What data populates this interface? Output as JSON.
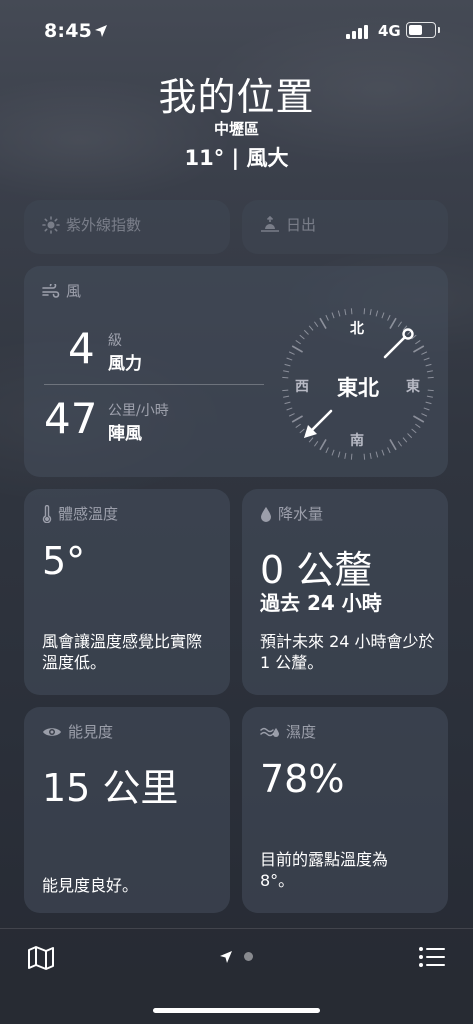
{
  "status_bar": {
    "time": "8:45",
    "network": "4G"
  },
  "header": {
    "title": "我的位置",
    "location": "中壢區",
    "summary": "11° | 風大"
  },
  "uv_card": {
    "label": "紫外線指數"
  },
  "sunrise_card": {
    "label": "日出"
  },
  "wind": {
    "label": "風",
    "level_value": "4",
    "level_unit": "級",
    "level_caption": "風力",
    "gust_value": "47",
    "gust_unit": "公里/小時",
    "gust_caption": "陣風",
    "direction": "東北",
    "compass": {
      "north": "北",
      "south": "南",
      "east": "東",
      "west": "西"
    }
  },
  "feels_like": {
    "label": "體感溫度",
    "value": "5°",
    "description": "風會讓溫度感覺比實際溫度低。"
  },
  "precipitation": {
    "label": "降水量",
    "value": "0 公釐",
    "period": "過去 24 小時",
    "description": "預計未來 24 小時會少於 1 公釐。"
  },
  "visibility": {
    "label": "能見度",
    "value": "15 公里",
    "description": "能見度良好。"
  },
  "humidity": {
    "label": "濕度",
    "value": "78%",
    "description": "目前的露點溫度為 8°。"
  },
  "toolbar": {
    "map_icon": "map-icon",
    "list_icon": "list-icon",
    "page_count": 2,
    "current_page": 0
  }
}
